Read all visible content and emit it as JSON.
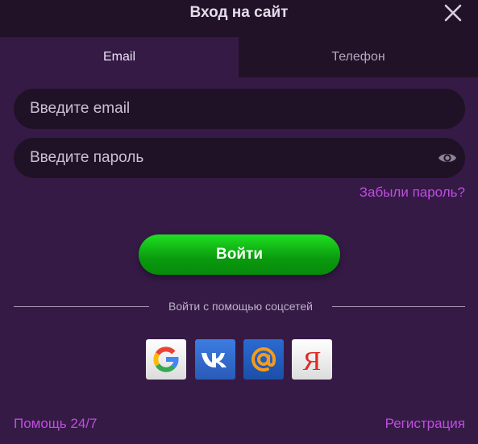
{
  "header": {
    "title": "Вход на сайт"
  },
  "tabs": [
    {
      "label": "Email",
      "active": true
    },
    {
      "label": "Телефон",
      "active": false
    }
  ],
  "form": {
    "email_placeholder": "Введите email",
    "email_value": "",
    "password_placeholder": "Введите пароль",
    "password_value": "",
    "forgot_label": "Забыли пароль?",
    "login_label": "Войти"
  },
  "social": {
    "divider_text": "Войти с помощью соцсетей",
    "providers": [
      {
        "name": "google",
        "icon": "google-icon"
      },
      {
        "name": "vk",
        "icon": "vk-icon"
      },
      {
        "name": "mail-ru",
        "icon": "at-sign-icon"
      },
      {
        "name": "yandex",
        "icon": "yandex-icon",
        "glyph": "Я"
      }
    ]
  },
  "footer": {
    "help_label": "Помощь 24/7",
    "register_label": "Регистрация"
  },
  "colors": {
    "background": "#351a46",
    "header": "#221228",
    "input": "#1f1226",
    "accent_link": "#c04de0",
    "button_green": "#0fb413"
  }
}
